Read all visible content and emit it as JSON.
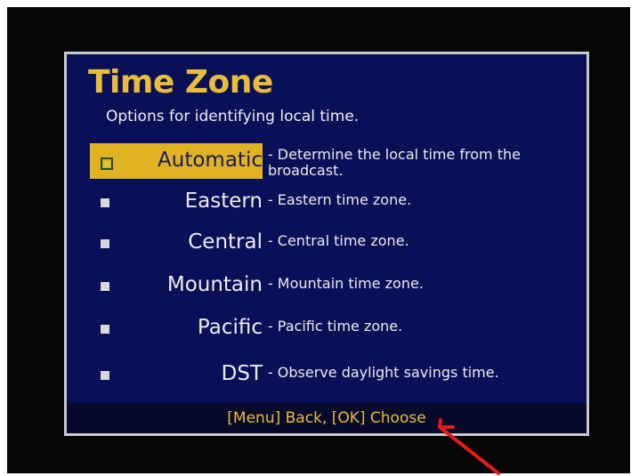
{
  "screen": {
    "title": "Time Zone",
    "subtitle": "Options for identifying local time."
  },
  "options": [
    {
      "label": "Automatic",
      "description": "Determine the local time from the broadcast.",
      "selected": true
    },
    {
      "label": "Eastern",
      "description": "Eastern time zone.",
      "selected": false
    },
    {
      "label": "Central",
      "description": "Central time zone.",
      "selected": false
    },
    {
      "label": "Mountain",
      "description": "Mountain time zone.",
      "selected": false
    },
    {
      "label": "Pacific",
      "description": "Pacific time zone.",
      "selected": false
    },
    {
      "label": "DST",
      "description": "Observe daylight savings time.",
      "selected": false
    }
  ],
  "footer": {
    "hint": "[Menu] Back, [OK] Choose"
  },
  "colors": {
    "panel": "#0a1058",
    "accent": "#e0b325",
    "footer": "#070a2a",
    "annotation_arrow": "#e31b1b"
  },
  "icons": {
    "annotation": "red-arrow-icon"
  }
}
